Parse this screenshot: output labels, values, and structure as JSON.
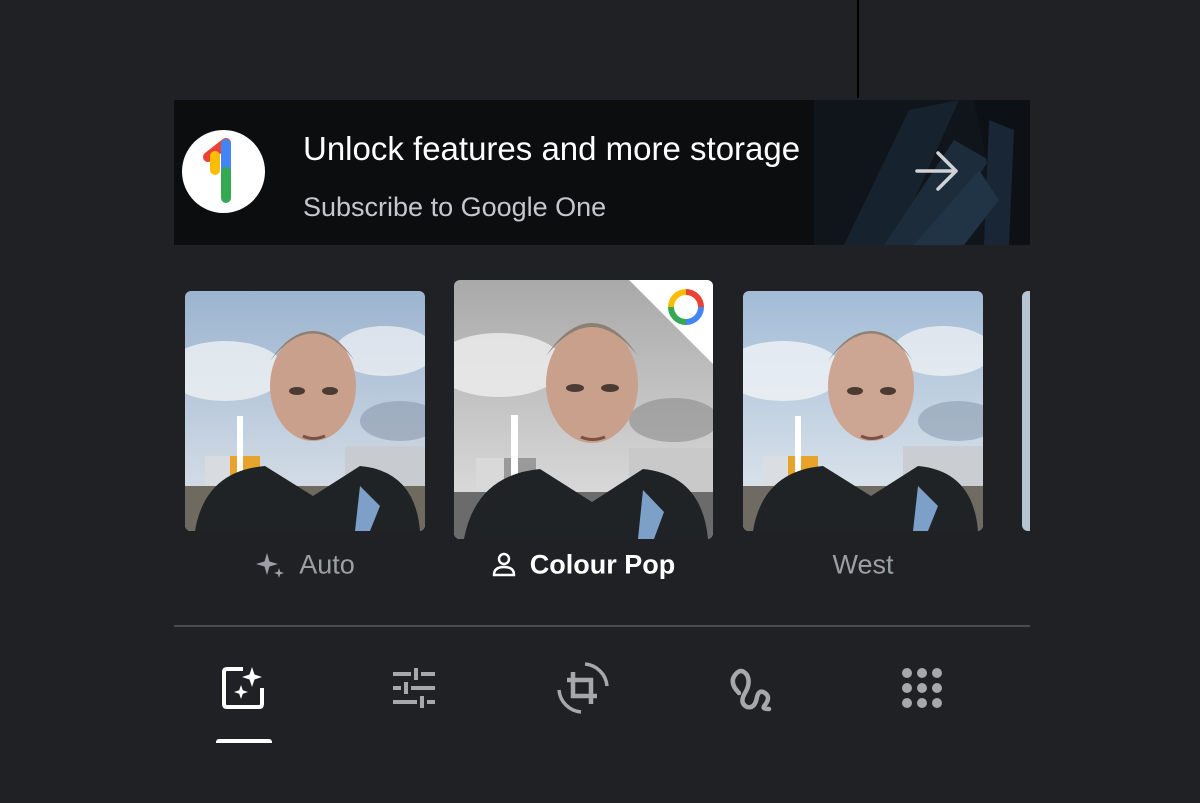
{
  "banner": {
    "title": "Unlock features and more storage",
    "subtitle": "Subscribe to Google One",
    "logo_icon": "google-one-icon",
    "arrow_icon": "arrow-right-icon"
  },
  "filters": [
    {
      "label": "Auto",
      "icon": "sparkle-icon",
      "selected": false
    },
    {
      "label": "Colour Pop",
      "icon": "person-icon",
      "selected": true,
      "badge": "google-one-badge-icon"
    },
    {
      "label": "West",
      "icon": "",
      "selected": false
    }
  ],
  "toolbar": {
    "tools": [
      {
        "name": "suggestions",
        "icon": "photo-sparkle-icon",
        "active": true
      },
      {
        "name": "adjust",
        "icon": "sliders-icon",
        "active": false
      },
      {
        "name": "crop",
        "icon": "crop-rotate-icon",
        "active": false
      },
      {
        "name": "markup",
        "icon": "markup-squiggle-icon",
        "active": false
      },
      {
        "name": "tools",
        "icon": "grid-dots-icon",
        "active": false
      }
    ]
  },
  "colors": {
    "background": "#202124",
    "selected_text": "#ffffff",
    "muted_text": "#9aa0a6",
    "g_blue": "#4285f4",
    "g_red": "#ea4335",
    "g_yellow": "#fbbc04",
    "g_green": "#34a853"
  }
}
